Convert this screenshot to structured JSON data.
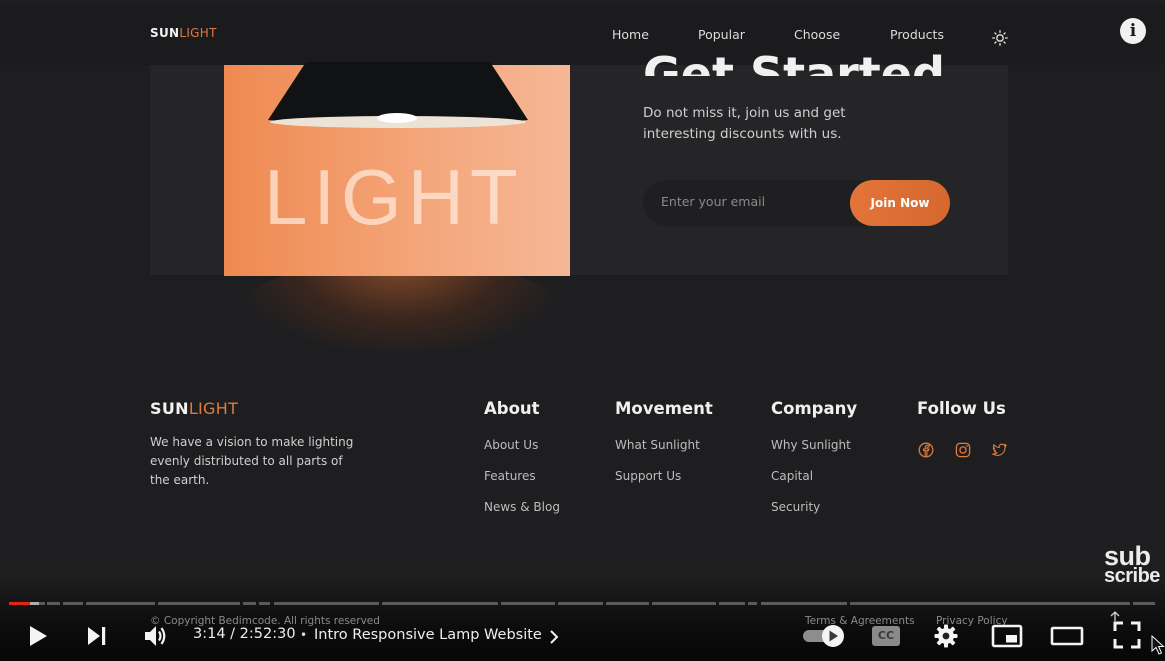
{
  "site": {
    "logo_part1": "SUN",
    "logo_part2": "LIGHT",
    "nav": [
      "Home",
      "Popular",
      "Choose",
      "Products"
    ],
    "theme_icon": "sun-icon"
  },
  "promo": {
    "heading": "Get Started",
    "lamp_word": "LIGHT",
    "description": "Do not miss it, join us and get interesting discounts with us.",
    "email_placeholder": "Enter your email",
    "join_label": "Join Now"
  },
  "footer": {
    "logo_part1": "SUN",
    "logo_part2": "LIGHT",
    "description": "We have a vision to make lighting evenly distributed to all parts of the earth.",
    "columns": [
      {
        "title": "About",
        "links": [
          "About Us",
          "Features",
          "News & Blog"
        ]
      },
      {
        "title": "Movement",
        "links": [
          "What Sunlight",
          "Support Us"
        ]
      },
      {
        "title": "Company",
        "links": [
          "Why Sunlight",
          "Capital",
          "Security"
        ]
      }
    ],
    "follow_title": "Follow Us",
    "social_icons": [
      "facebook-icon",
      "instagram-icon",
      "twitter-icon"
    ],
    "copyright": "© Copyright Bedimcode. All rights reserved",
    "terms": "Terms & Agreements",
    "privacy": "Privacy Policy"
  },
  "watermark": {
    "line1": "sub",
    "line2": "scribe"
  },
  "player": {
    "time_display": "3:14 / 2:52:30",
    "separator": "•",
    "chapter_title": "Intro Responsive Lamp Website",
    "played_fraction": 0.0185,
    "autoplay": "on",
    "cc_label": "CC",
    "accent_color": "#e62117",
    "brand_accent": "#e07a3c"
  }
}
